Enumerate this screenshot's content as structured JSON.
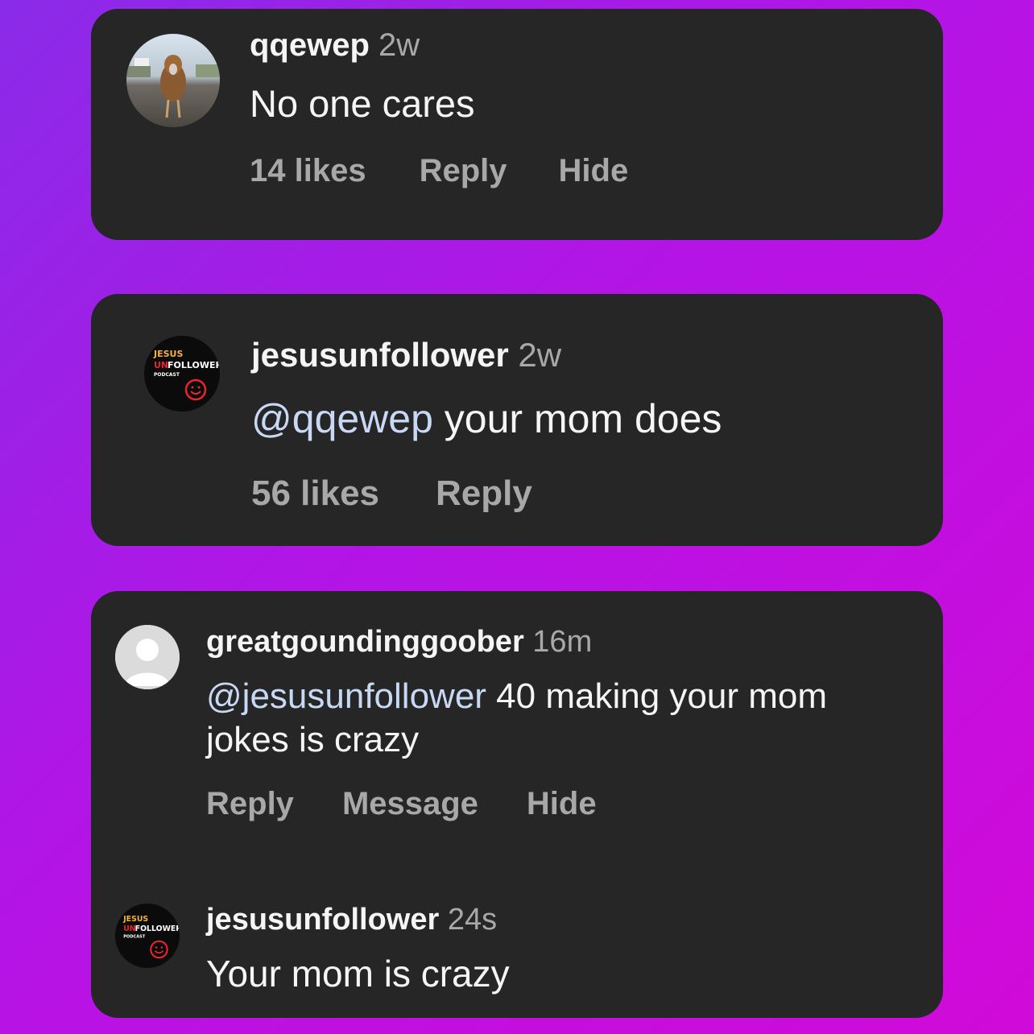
{
  "comments": [
    {
      "username": "qqewep",
      "time": "2w",
      "text": "No one cares",
      "actions": {
        "likes": "14 likes",
        "reply": "Reply",
        "hide": "Hide"
      }
    },
    {
      "username": "jesusunfollower",
      "time": "2w",
      "mention": "@qqewep",
      "text": " your mom does",
      "actions": {
        "likes": "56 likes",
        "reply": "Reply"
      }
    },
    {
      "username": "greatgoundinggoober",
      "time": "16m",
      "mention": "@jesusunfollower",
      "text_line1": " 40 making your mom",
      "text_line2": "jokes is crazy",
      "actions": {
        "reply": "Reply",
        "message": "Message",
        "hide": "Hide"
      }
    },
    {
      "username": "jesusunfollower",
      "time": "24s",
      "text": "Your mom is crazy"
    }
  ],
  "logo": {
    "line1": "JESUS",
    "line2a": "UN",
    "line2b": "FOLLOWER",
    "line3": "PODCAST"
  },
  "colors": {
    "card": "#262626",
    "muted": "#a8a8a8",
    "mention": "#c8d9f5",
    "logo_red": "#e8262b",
    "logo_yellow": "#f2b23a"
  }
}
